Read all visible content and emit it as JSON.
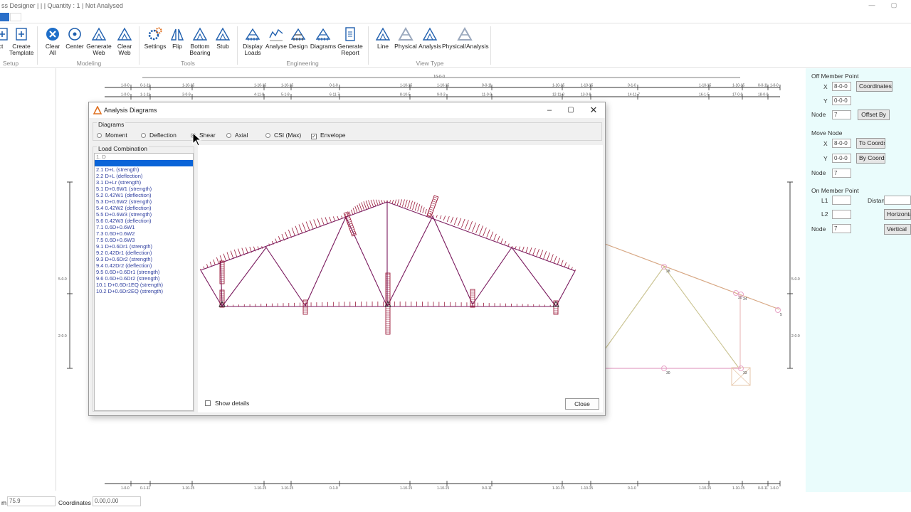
{
  "app": {
    "title": "ss Designer |  |  | Quantity : 1 | Not Analysed",
    "win_min": "—",
    "win_max": "▢"
  },
  "ribbon": {
    "buttons": [
      {
        "label": "ct",
        "icon": "select-icon"
      },
      {
        "label": "Create\nTemplate",
        "icon": "template-icon"
      },
      {
        "label": "Clear\nAll",
        "icon": "clear-all-icon"
      },
      {
        "label": "Center",
        "icon": "center-icon"
      },
      {
        "label": "Generate\nWeb",
        "icon": "generate-web-icon"
      },
      {
        "label": "Clear\nWeb",
        "icon": "clear-web-icon"
      },
      {
        "label": "Settings",
        "icon": "settings-icon"
      },
      {
        "label": "Flip",
        "icon": "flip-icon"
      },
      {
        "label": "Bottom\nBearing",
        "icon": "bottom-bearing-icon"
      },
      {
        "label": "Stub",
        "icon": "stub-icon"
      },
      {
        "label": "Display\nLoads",
        "icon": "display-loads-icon"
      },
      {
        "label": "Analyse",
        "icon": "analyse-icon"
      },
      {
        "label": "Design",
        "icon": "design-icon"
      },
      {
        "label": "Diagrams",
        "icon": "diagrams-icon"
      },
      {
        "label": "Generate\nReport",
        "icon": "report-icon"
      },
      {
        "label": "Line",
        "icon": "line-view-icon"
      },
      {
        "label": "Physical",
        "icon": "physical-view-icon"
      },
      {
        "label": "Analysis",
        "icon": "analysis-view-icon"
      },
      {
        "label": "Physical/Analysis",
        "icon": "physical-analysis-view-icon"
      }
    ],
    "groups": [
      "Setup",
      "Modeling",
      "Tools",
      "Engineering",
      "View Type"
    ]
  },
  "ruler": {
    "top_label": "16-0-0",
    "row1": [
      "1-0-0",
      "0-1-11",
      "1-10-15",
      "1-10-15",
      "1-10-15",
      "0-1-0",
      "1-10-15",
      "1-10-15",
      "0-0-11",
      "1-10-15",
      "1-10-15",
      "0-1-0",
      "1-10-15",
      "1-10-15",
      "0-0-11",
      "1-0-0"
    ],
    "row2": [
      "1-0-0",
      "1-1-11",
      "3-0-9",
      "4-11-8",
      "5-1-8",
      "6-11-7",
      "8-10-5",
      "9-0-3",
      "11-0-9",
      "12-11-8",
      "13-0-8",
      "14-11-7",
      "16-1-5",
      "17-0-0",
      "18-0-0"
    ],
    "bottom": [
      "1-0-0",
      "0-1-11",
      "1-10-15",
      "1-10-15",
      "1-10-15",
      "0-1-0",
      "1-10-15",
      "1-10-15",
      "0-0-11",
      "1-10-15",
      "1-10-15",
      "0-1-0",
      "1-10-15",
      "1-10-15",
      "0-0-11",
      "1-0-0"
    ],
    "left_marks": [
      "5-0-0",
      "2-0-0"
    ],
    "right_marks": [
      "5-0-0",
      "2-0-0"
    ],
    "node_labels": [
      "28",
      "30",
      "34",
      "5",
      "30",
      "33"
    ]
  },
  "right_panel": {
    "off_member": {
      "title": "Off Member Point",
      "x_label": "X",
      "x_value": "8-0-0",
      "y_label": "Y",
      "y_value": "0-0-0",
      "node_label": "Node",
      "node_value": "7",
      "btn_coords": "Coordinates",
      "btn_offset": "Offset By"
    },
    "move_node": {
      "title": "Move Node",
      "x_label": "X",
      "x_value": "8-0-0",
      "y_label": "Y",
      "y_value": "0-0-0",
      "node_label": "Node",
      "node_value": "7",
      "btn_to": "To Coords",
      "btn_by": "By Coords"
    },
    "on_member": {
      "title": "On Member Point",
      "l1_label": "L1",
      "l1_value": "",
      "l2_label": "L2",
      "l2_value": "",
      "node_label": "Node",
      "node_value": "7",
      "distance_label": "Distance",
      "distance_value": "",
      "btn_horizontal": "Horizonta",
      "btn_vertical": "Vertical"
    }
  },
  "statusbar": {
    "zoom_label": "m",
    "zoom_value": "75.9",
    "coords_label": "Coordinates",
    "coords_value": "0.00,0.00"
  },
  "dialog": {
    "title": "Analysis Diagrams",
    "diagrams_legend": "Diagrams",
    "options": [
      {
        "label": "Moment",
        "selected": false
      },
      {
        "label": "Deflection",
        "selected": false
      },
      {
        "label": "Shear",
        "selected": true
      },
      {
        "label": "Axial",
        "selected": false
      },
      {
        "label": "CSI (Max)",
        "selected": false
      }
    ],
    "envelope_label": "Envelope",
    "envelope_checked": true,
    "load_combination_legend": "Load Combination",
    "load_combinations": [
      "1. D",
      "",
      "2.1 D+L (strength)",
      "2.2 D+L (deflection)",
      "3.1 D+Lr (strength)",
      "5.1 D+0.6W1 (strength)",
      "5.2 0.42W1 (deflection)",
      "5.3 D+0.6W2 (strength)",
      "5.4 0.42W2 (deflection)",
      "5.5 D+0.6W3 (strength)",
      "5.6 0.42W3 (deflection)",
      "7.1 0.6D+0.6W1",
      "7.3 0.6D+0.6W2",
      "7.5 0.6D+0.6W3",
      "9.1 D+0.6Dr1 (strength)",
      "9.2 0.42Dr1 (deflection)",
      "9.3 D+0.6Dr2 (strength)",
      "9.4 0.42Dr2 (deflection)",
      "9.5 0.6D+0.6Dr1 (strength)",
      "9.6 0.6D+0.6Dr2 (strength)",
      "10.1 D+0.6Dr1EQ (strength)",
      "10.2 D+0.6Dr2EQ (strength)"
    ],
    "selected_index": 1,
    "show_details_label": "Show details",
    "close_label": "Close",
    "colors": {
      "diagram": "#9b1b3a",
      "truss": "#7a1a5e",
      "selection": "#0a64d8"
    }
  }
}
